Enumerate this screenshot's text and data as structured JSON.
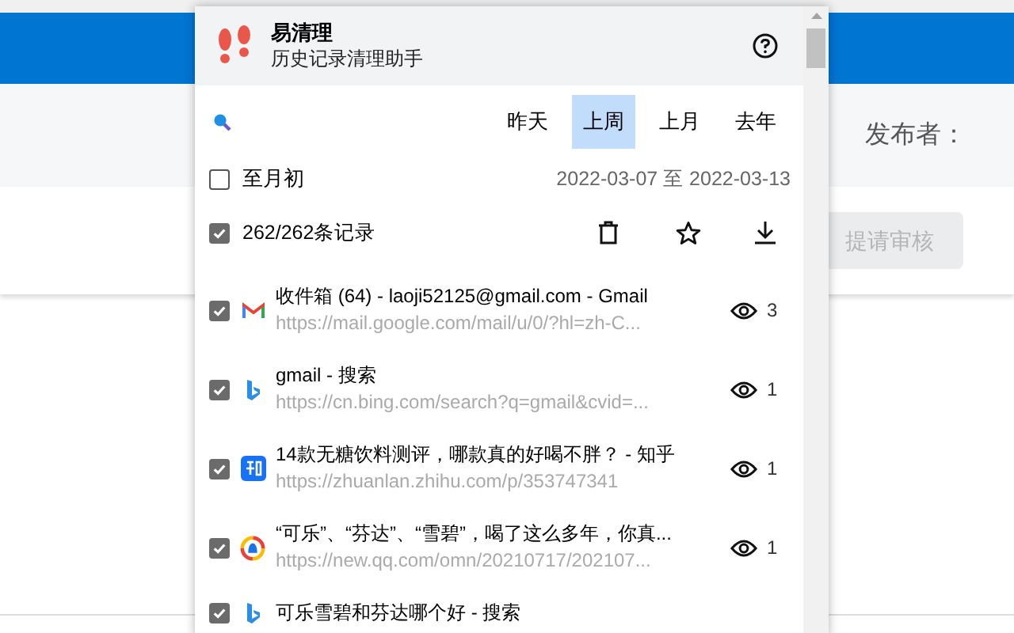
{
  "background_page": {
    "publisher_label": "发布者：",
    "submit_button": {
      "label": "提请审核",
      "disabled": true
    }
  },
  "popup": {
    "app_name": "易清理",
    "app_subtitle": "历史记录清理助手",
    "ranges": [
      {
        "label": "昨天",
        "selected": false
      },
      {
        "label": "上周",
        "selected": true
      },
      {
        "label": "上月",
        "selected": false
      },
      {
        "label": "去年",
        "selected": false
      }
    ],
    "month_start": {
      "label": "至月初",
      "checked": false
    },
    "date_range": "2022-03-07 至 2022-03-13",
    "select_all": {
      "label": "262/262条记录",
      "checked": true
    },
    "records": [
      {
        "kind": "gmail",
        "title": "收件箱 (64) - laoji52125@gmail.com - Gmail",
        "url": "https://mail.google.com/mail/u/0/?hl=zh-C...",
        "visits": "3",
        "checked": true
      },
      {
        "kind": "bing",
        "title": "gmail - 搜索",
        "url": "https://cn.bing.com/search?q=gmail&cvid=...",
        "visits": "1",
        "checked": true
      },
      {
        "kind": "zhihu",
        "title": "14款无糖饮料测评，哪款真的好喝不胖？ - 知乎",
        "url": "https://zhuanlan.zhihu.com/p/353747341",
        "visits": "1",
        "checked": true
      },
      {
        "kind": "qq",
        "title": "“可乐”、“芬达”、“雪碧”，喝了这么多年，你真...",
        "url": "https://new.qq.com/omn/20210717/202107...",
        "visits": "1",
        "checked": true
      },
      {
        "kind": "bing",
        "title": "可乐雪碧和芬达哪个好 - 搜索",
        "checked": true
      }
    ]
  }
}
